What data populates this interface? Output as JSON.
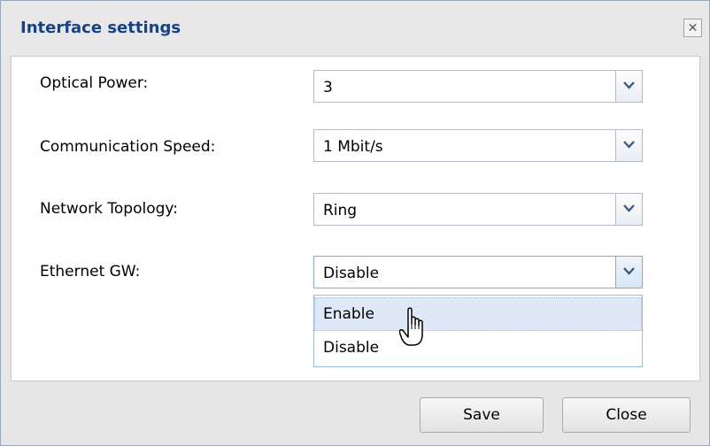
{
  "dialog": {
    "title": "Interface settings",
    "close_glyph": "✕"
  },
  "fields": [
    {
      "label": "Optical Power:",
      "value": "3"
    },
    {
      "label": "Communication Speed:",
      "value": "1 Mbit/s"
    },
    {
      "label": "Network Topology:",
      "value": "Ring"
    },
    {
      "label": "Ethernet GW:",
      "value": "Disable"
    }
  ],
  "dropdown": {
    "options": [
      "Enable",
      "Disable"
    ],
    "hovered": "Enable"
  },
  "buttons": {
    "save": "Save",
    "close": "Close"
  },
  "colors": {
    "title": "#15428b",
    "hover_bg": "#dfe8f6",
    "accent_border": "#7eadd9"
  }
}
